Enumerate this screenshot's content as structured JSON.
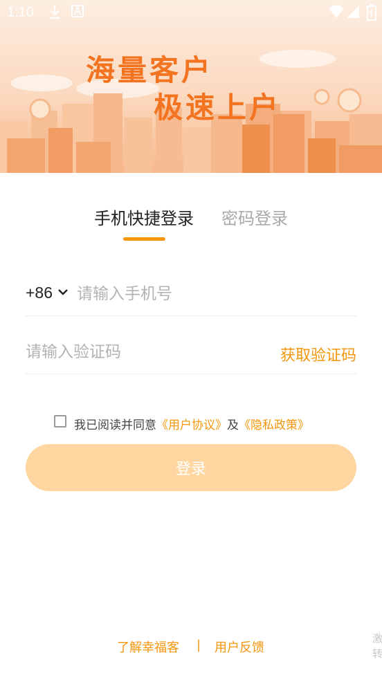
{
  "status_bar": {
    "time": "1:10"
  },
  "banner": {
    "slogan_line1": "海量客户",
    "slogan_line2": "极速上户"
  },
  "tabs": [
    {
      "label": "手机快捷登录",
      "active": true
    },
    {
      "label": "密码登录",
      "active": false
    }
  ],
  "phone": {
    "country_code": "+86",
    "placeholder": "请输入手机号"
  },
  "verify": {
    "placeholder": "请输入验证码",
    "get_code_label": "获取验证码"
  },
  "agreement": {
    "prefix": "我已阅读并同意",
    "user_agreement": "《用户协议》",
    "conjunction": "及",
    "privacy_policy": "《隐私政策》",
    "checked": false
  },
  "login_button": {
    "label": "登录"
  },
  "footer": {
    "about": "了解幸福客",
    "separator": "|",
    "feedback": "用户反馈"
  },
  "corner_text": {
    "line1": "激",
    "line2": "转"
  },
  "colors": {
    "accent": "#f5960d",
    "button_disabled": "#ffd6a0",
    "slogan": "#f27420"
  },
  "icons": [
    "download-icon",
    "a-notification-icon",
    "wifi-icon",
    "signal-icon",
    "battery-icon",
    "chevron-down-icon",
    "checkbox-icon"
  ]
}
